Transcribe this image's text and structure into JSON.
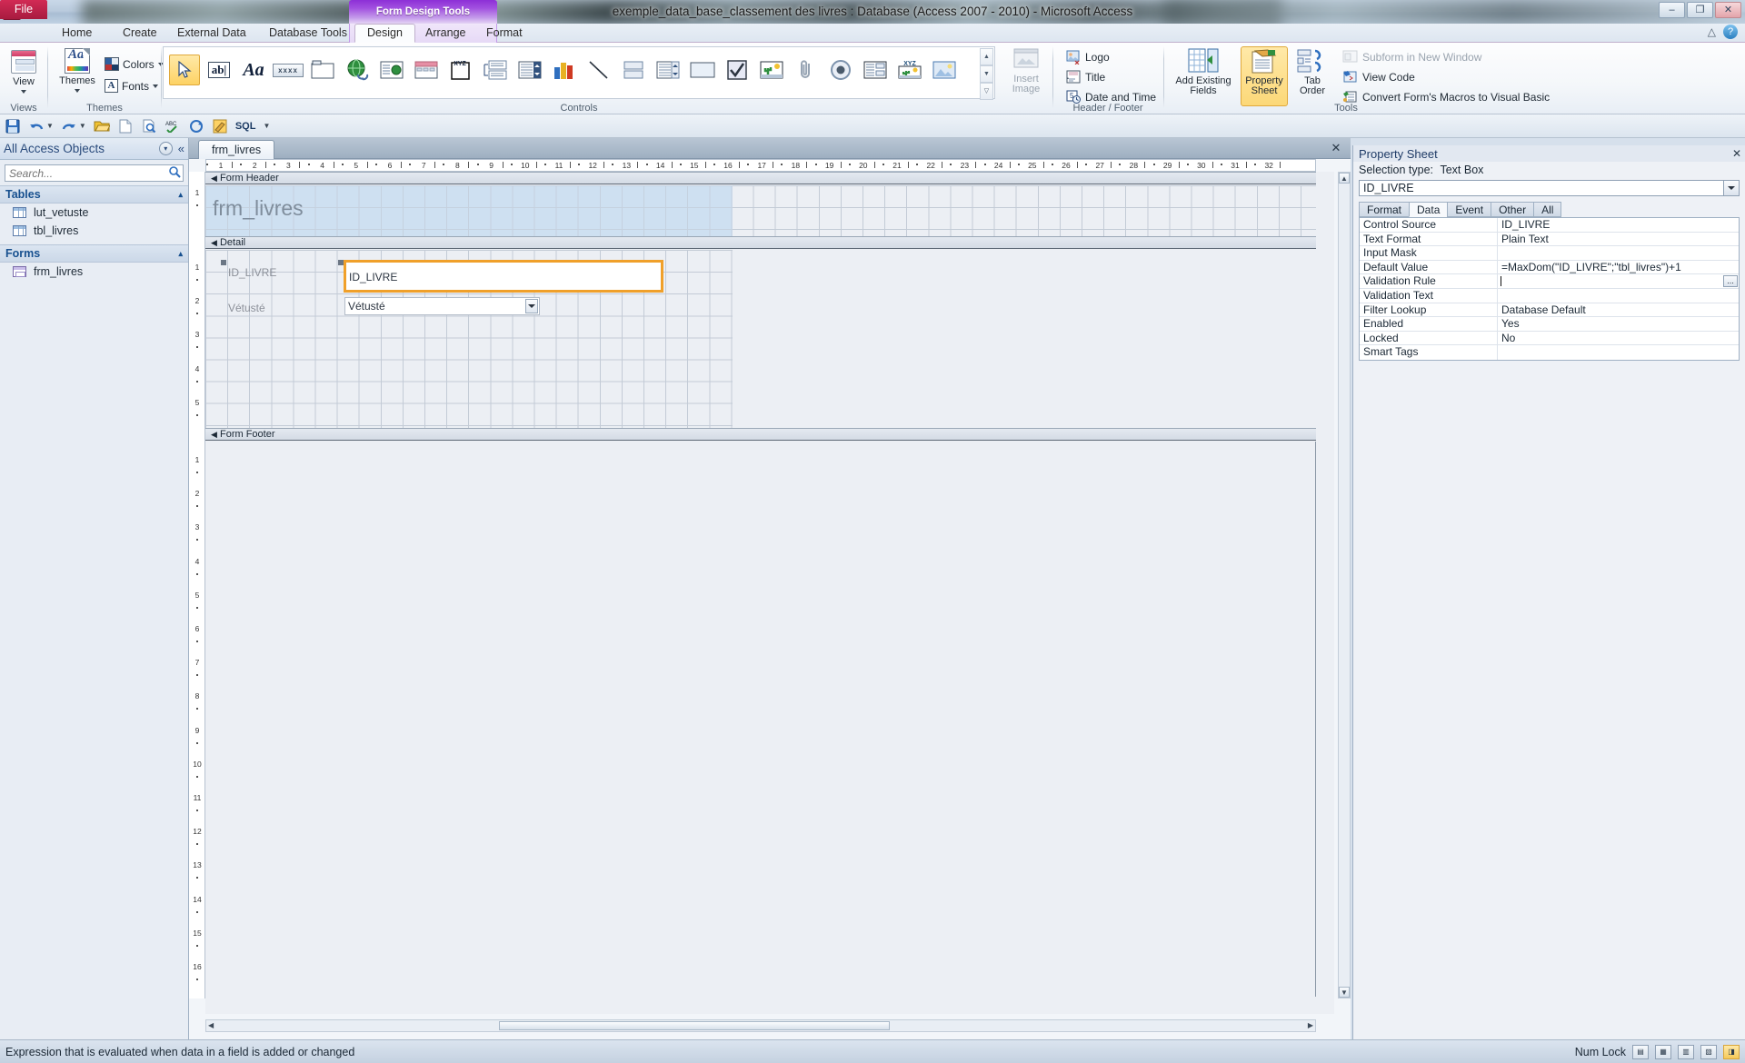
{
  "window": {
    "app_logo": "A",
    "title": "exemple_data_base_classement des livres : Database (Access 2007 - 2010)  -  Microsoft Access",
    "contextual_banner": "Form Design Tools",
    "minimize": "–",
    "maximize": "❐",
    "close": "✕",
    "help_icon": "?",
    "ribbon_minimize_icon": "△"
  },
  "tabs": [
    {
      "label": "File",
      "kind": "file"
    },
    {
      "label": "Home",
      "kind": "normal"
    },
    {
      "label": "Create",
      "kind": "normal"
    },
    {
      "label": "External Data",
      "kind": "normal"
    },
    {
      "label": "Database Tools",
      "kind": "normal"
    },
    {
      "label": "Design",
      "kind": "active"
    },
    {
      "label": "Arrange",
      "kind": "contextual"
    },
    {
      "label": "Format",
      "kind": "contextual"
    }
  ],
  "ribbon": {
    "groups": [
      {
        "name": "Views"
      },
      {
        "name": "Themes"
      },
      {
        "name": "Controls"
      },
      {
        "name": "Header / Footer"
      },
      {
        "name": "Tools"
      }
    ],
    "views": {
      "button": "View",
      "icon": "view-icon"
    },
    "themes": {
      "button": "Themes",
      "colors": "Colors",
      "fonts": "Fonts"
    },
    "controls": {
      "items": [
        {
          "name": "select-tool",
          "icon": "arrow-pointer-icon",
          "selected": true
        },
        {
          "name": "text-box-tool",
          "icon": "textbox-ab-icon"
        },
        {
          "name": "label-tool",
          "icon": "label-Aa-icon"
        },
        {
          "name": "button-tool",
          "icon": "button-xxxx-icon"
        },
        {
          "name": "tab-control-tool",
          "icon": "tab-control-icon"
        },
        {
          "name": "hyperlink-tool",
          "icon": "globe-link-icon"
        },
        {
          "name": "web-browser-tool",
          "icon": "web-browser-icon"
        },
        {
          "name": "navigation-control-tool",
          "icon": "navigation-control-icon"
        },
        {
          "name": "option-group-tool",
          "icon": "option-group-icon"
        },
        {
          "name": "page-break-tool",
          "icon": "page-break-xyz-icon"
        },
        {
          "name": "combo-box-tool",
          "icon": "combo-box-icon"
        },
        {
          "name": "chart-tool",
          "icon": "bar-chart-icon"
        },
        {
          "name": "line-tool",
          "icon": "line-icon"
        },
        {
          "name": "toggle-button-tool",
          "icon": "toggle-button-icon"
        },
        {
          "name": "list-box-tool",
          "icon": "list-box-icon"
        },
        {
          "name": "rectangle-tool",
          "icon": "rectangle-icon"
        },
        {
          "name": "check-box-tool",
          "icon": "check-box-icon"
        },
        {
          "name": "unbound-object-frame-tool",
          "icon": "cactus-image-icon"
        },
        {
          "name": "attachment-tool",
          "icon": "paperclip-icon"
        },
        {
          "name": "option-button-tool",
          "icon": "option-button-icon"
        },
        {
          "name": "subform-subreport-tool",
          "icon": "subform-icon"
        },
        {
          "name": "bound-object-frame-tool",
          "icon": "bound-object-xyz-icon"
        },
        {
          "name": "image-tool",
          "icon": "picture-icon"
        }
      ],
      "insert_image": "Insert\nImage",
      "insert_image_line1": "Insert",
      "insert_image_line2": "Image"
    },
    "header_footer": {
      "logo": "Logo",
      "title": "Title",
      "date_and_time": "Date and Time"
    },
    "tools": {
      "add_existing_fields_line1": "Add Existing",
      "add_existing_fields_line2": "Fields",
      "property_sheet_line1": "Property",
      "property_sheet_line2": "Sheet",
      "tab_order_line1": "Tab",
      "tab_order_line2": "Order",
      "subform_in_new_window": "Subform in New Window",
      "view_code": "View Code",
      "convert_macros": "Convert Form's Macros to Visual Basic"
    }
  },
  "quick_access": {
    "items": [
      {
        "name": "save-icon",
        "glyph": "ὋE"
      },
      {
        "name": "undo-icon",
        "glyph": "↶"
      },
      {
        "name": "redo-icon",
        "glyph": "↷"
      },
      {
        "name": "open-icon",
        "glyph": "Ὄ2"
      },
      {
        "name": "new-icon",
        "glyph": "὜B"
      },
      {
        "name": "print-preview-icon",
        "glyph": "ὐD"
      },
      {
        "name": "spelling-icon",
        "glyph": "ABC"
      },
      {
        "name": "refresh-icon",
        "glyph": "↻"
      },
      {
        "name": "design-view-icon",
        "glyph": "✎"
      },
      {
        "name": "sql-view-icon",
        "glyph": "SQL"
      },
      {
        "name": "customize-qat-icon",
        "glyph": "▾"
      }
    ]
  },
  "nav_pane": {
    "header": "All Access Objects",
    "collapse_icon": "«",
    "dropdown_icon": "▾",
    "search": {
      "placeholder": "Search...",
      "value": "",
      "icon": "search-icon"
    },
    "groups": [
      {
        "label": "Tables",
        "collapse": "▴",
        "items": [
          {
            "label": "lut_vetuste",
            "icon": "table-icon"
          },
          {
            "label": "tbl_livres",
            "icon": "table-icon"
          }
        ]
      },
      {
        "label": "Forms",
        "collapse": "▴",
        "items": [
          {
            "label": "frm_livres",
            "icon": "form-icon"
          }
        ]
      }
    ]
  },
  "document": {
    "tab_label": "frm_livres",
    "close_icon": "✕",
    "sections": [
      {
        "label": "Form Header",
        "marker": "◀"
      },
      {
        "label": "Detail",
        "marker": "◀"
      },
      {
        "label": "Form Footer",
        "marker": "◀"
      }
    ],
    "form_title": "frm_livres",
    "controls": [
      {
        "label": "ID_LIVRE",
        "value": "ID_LIVRE",
        "type": "textbox",
        "selected": true
      },
      {
        "label": "Vétusté",
        "value": "Vétusté",
        "type": "combobox",
        "selected": false
      }
    ],
    "h_ruler_numbers": [
      "1",
      "2",
      "3",
      "4",
      "5",
      "6",
      "7",
      "8",
      "9",
      "10",
      "11",
      "12",
      "13",
      "14",
      "15",
      "16",
      "17",
      "18",
      "19",
      "20",
      "21",
      "22",
      "23",
      "24",
      "25",
      "26",
      "27",
      "28",
      "29",
      "30",
      "31",
      "32"
    ],
    "v_ruler_header": [
      "1"
    ],
    "v_ruler_detail": [
      "1",
      "2",
      "3",
      "4",
      "5"
    ],
    "v_ruler_footer": [
      "1",
      "2",
      "3",
      "4",
      "5",
      "6",
      "7",
      "8",
      "9",
      "10",
      "11",
      "12",
      "13",
      "14",
      "15",
      "16"
    ]
  },
  "property_sheet": {
    "title": "Property Sheet",
    "close_icon": "✕",
    "selection_type_label": "Selection type:",
    "selection_type_value": "Text Box",
    "selected_object": "ID_LIVRE",
    "dropdown_icon": "▾",
    "tabs": [
      {
        "label": "Format",
        "active": false
      },
      {
        "label": "Data",
        "active": true
      },
      {
        "label": "Event",
        "active": false
      },
      {
        "label": "Other",
        "active": false
      },
      {
        "label": "All",
        "active": false
      }
    ],
    "rows": [
      {
        "key": "Control Source",
        "value": "ID_LIVRE",
        "focused": false
      },
      {
        "key": "Text Format",
        "value": "Plain Text",
        "focused": false
      },
      {
        "key": "Input Mask",
        "value": "",
        "focused": false
      },
      {
        "key": "Default Value",
        "value": "=MaxDom(\"ID_LIVRE\";\"tbl_livres\")+1",
        "focused": false
      },
      {
        "key": "Validation Rule",
        "value": "",
        "focused": true,
        "ellipsis": "..."
      },
      {
        "key": "Validation Text",
        "value": "",
        "focused": false
      },
      {
        "key": "Filter Lookup",
        "value": "Database Default",
        "focused": false
      },
      {
        "key": "Enabled",
        "value": "Yes",
        "focused": false
      },
      {
        "key": "Locked",
        "value": "No",
        "focused": false
      },
      {
        "key": "Smart Tags",
        "value": "",
        "focused": false
      }
    ]
  },
  "status_bar": {
    "message": "Expression that is evaluated when data in a field is added or changed",
    "num_lock": "Num Lock",
    "view_buttons": [
      {
        "name": "form-view-button",
        "glyph": "▤",
        "active": false
      },
      {
        "name": "layout-view-button",
        "glyph": "▦",
        "active": false
      },
      {
        "name": "datasheet-view-button",
        "glyph": "▥",
        "active": false
      },
      {
        "name": "pivot-view-button",
        "glyph": "▧",
        "active": false
      },
      {
        "name": "design-view-button",
        "glyph": "◨",
        "active": true
      }
    ]
  },
  "colors": {
    "accent_red": "#c8264b",
    "contextual_purple": "#8d2fd6",
    "selection_orange": "#f0a02a",
    "header_blue": "#c9ddf0"
  }
}
